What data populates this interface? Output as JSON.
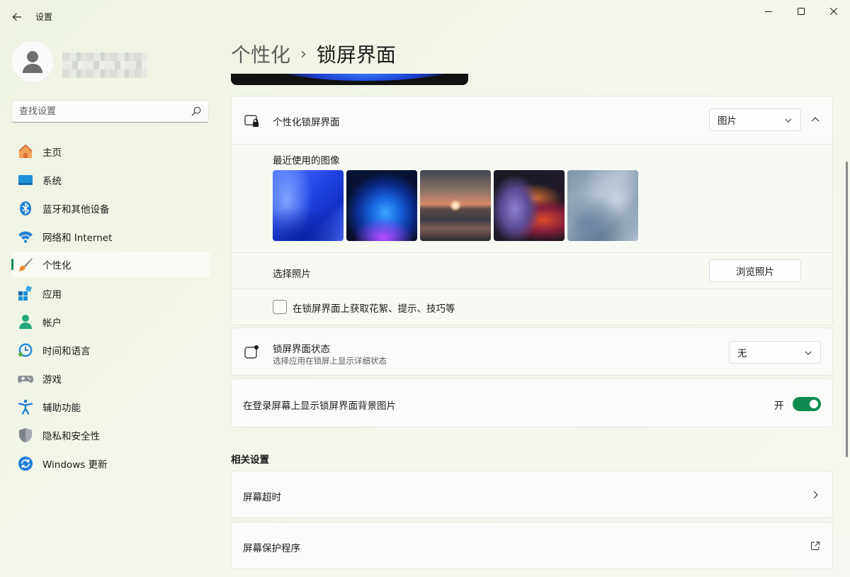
{
  "window": {
    "title": "设置",
    "controls": {
      "minimize": "minimize-icon",
      "maximize": "maximize-icon",
      "close": "close-icon"
    }
  },
  "sidebar": {
    "search": {
      "placeholder": "查找设置",
      "value": ""
    },
    "items": [
      {
        "label": "主页",
        "icon": "home-icon",
        "selected": false
      },
      {
        "label": "系统",
        "icon": "system-icon",
        "selected": false
      },
      {
        "label": "蓝牙和其他设备",
        "icon": "bluetooth-icon",
        "selected": false
      },
      {
        "label": "网络和 Internet",
        "icon": "wifi-icon",
        "selected": false
      },
      {
        "label": "个性化",
        "icon": "brush-icon",
        "selected": true
      },
      {
        "label": "应用",
        "icon": "apps-icon",
        "selected": false
      },
      {
        "label": "帐户",
        "icon": "account-icon",
        "selected": false
      },
      {
        "label": "时间和语言",
        "icon": "time-language-icon",
        "selected": false
      },
      {
        "label": "游戏",
        "icon": "gamepad-icon",
        "selected": false
      },
      {
        "label": "辅助功能",
        "icon": "accessibility-icon",
        "selected": false
      },
      {
        "label": "隐私和安全性",
        "icon": "shield-icon",
        "selected": false
      },
      {
        "label": "Windows 更新",
        "icon": "update-icon",
        "selected": false
      }
    ]
  },
  "header": {
    "breadcrumb_parent": "个性化",
    "breadcrumb_separator": "›",
    "breadcrumb_current": "锁屏界面"
  },
  "lock_screen_card": {
    "title": "个性化锁屏界面",
    "mode_value": "图片",
    "expanded": true,
    "recent_images_label": "最近使用的图像",
    "recent_images": [
      "thumbnail-blue-bloom",
      "thumbnail-blue-glow",
      "thumbnail-sunset",
      "thumbnail-purple-ribbon",
      "thumbnail-gray-bloom"
    ],
    "choose_photo_label": "选择照片",
    "browse_button": "浏览照片",
    "tips_checkbox_label": "在锁屏界面上获取花絮、提示、技巧等",
    "tips_checked": false
  },
  "status_card": {
    "title": "锁屏界面状态",
    "subtitle": "选择应用在锁屏上显示详细状态",
    "value": "无"
  },
  "signin_card": {
    "title": "在登录屏幕上显示锁屏界面背景图片",
    "toggle_label": "开",
    "toggle_on": true
  },
  "related": {
    "heading": "相关设置",
    "items": [
      {
        "label": "屏幕超时",
        "icon": "chevron-right-icon"
      },
      {
        "label": "屏幕保护程序",
        "icon": "external-link-icon"
      }
    ]
  },
  "colors": {
    "accent": "#0f8a4f",
    "background": "#f0f5e6",
    "card": "#fbfcfa"
  }
}
